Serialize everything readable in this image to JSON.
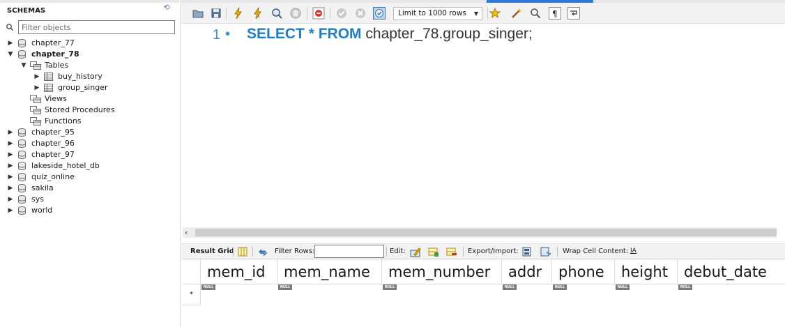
{
  "navigator": {
    "title": "SCHEMAS",
    "filter_placeholder": "Filter objects",
    "schemas": [
      {
        "name": "chapter_77",
        "expanded": false
      },
      {
        "name": "chapter_78",
        "expanded": true,
        "bold": true,
        "children": [
          {
            "name": "Tables",
            "expanded": true,
            "children": [
              {
                "name": "buy_history"
              },
              {
                "name": "group_singer"
              }
            ]
          },
          {
            "name": "Views"
          },
          {
            "name": "Stored Procedures"
          },
          {
            "name": "Functions"
          }
        ]
      },
      {
        "name": "chapter_95",
        "expanded": false
      },
      {
        "name": "chapter_96",
        "expanded": false
      },
      {
        "name": "chapter_97",
        "expanded": false
      },
      {
        "name": "lakeside_hotel_db",
        "expanded": false
      },
      {
        "name": "quiz_online",
        "expanded": false
      },
      {
        "name": "sakila",
        "expanded": false
      },
      {
        "name": "sys",
        "expanded": false
      },
      {
        "name": "world",
        "expanded": false
      }
    ]
  },
  "toolbar": {
    "limit_label": "Limit to 1000 rows",
    "icons": [
      "open-folder-icon",
      "save-icon",
      "execute-icon",
      "execute-statement-icon",
      "explain-icon",
      "stop-icon",
      "toggle-error-icon",
      "commit-icon",
      "rollback-icon",
      "autocommit-icon",
      "bookmark-icon",
      "beautify-icon",
      "find-icon",
      "invisible-chars-icon",
      "wrap-icon"
    ]
  },
  "editor": {
    "line_number": "1",
    "line_marker": "•",
    "kw_select": "SELECT",
    "star": "*",
    "kw_from": "FROM",
    "identifier": "chapter_78.group_singer;"
  },
  "result_toolbar": {
    "result_grid": "Result Grid",
    "filter_rows": "Filter Rows:",
    "edit": "Edit:",
    "export_import": "Export/Import:",
    "wrap_cell": "Wrap Cell Content:",
    "wrap_glyph": "IA"
  },
  "grid": {
    "columns": [
      "mem_id",
      "mem_name",
      "mem_number",
      "addr",
      "phone",
      "height",
      "debut_date"
    ],
    "null_label": "NULL",
    "new_row_marker": "*"
  },
  "colors": {
    "keyword": "#1f7ec4",
    "line_number": "#3a8fd1",
    "active_tab": "#2f7ad6"
  }
}
